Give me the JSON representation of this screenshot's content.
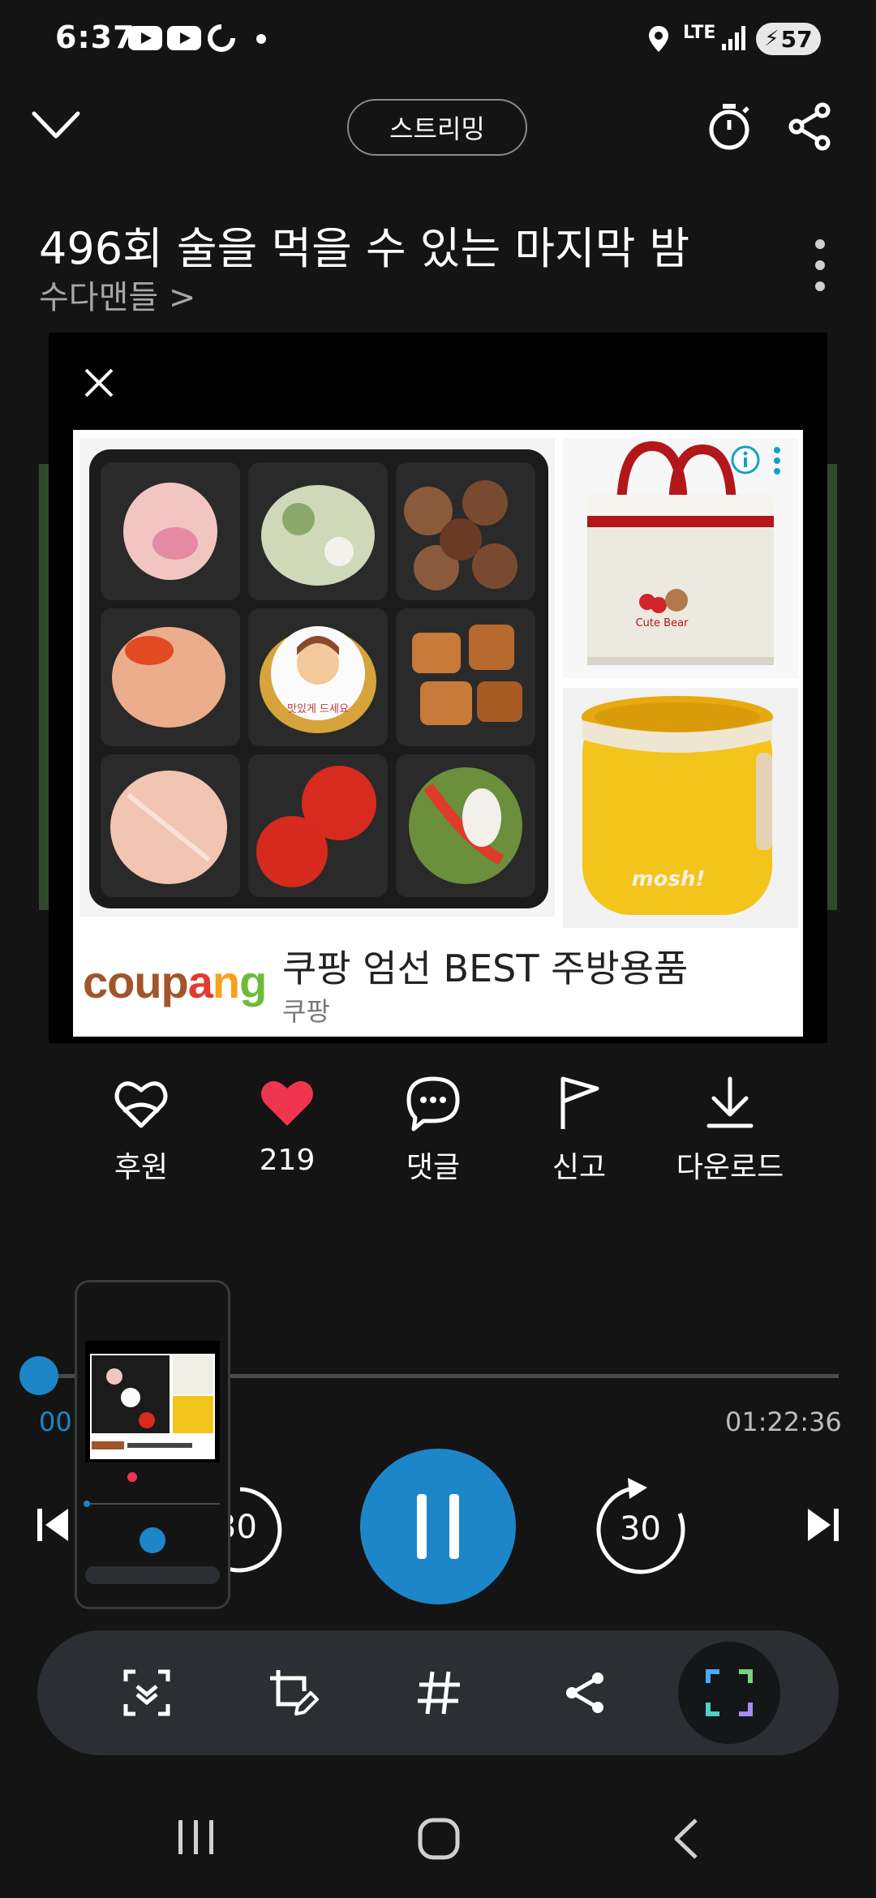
{
  "status_bar": {
    "time": "6:37",
    "network": "LTE",
    "battery": "57"
  },
  "header": {
    "streaming_label": "스트리밍",
    "episode_title": "496회 술을 먹을 수 있는 마지막 밤",
    "channel_name": "수다맨들 >"
  },
  "ad": {
    "brand": "coupang",
    "title": "쿠팡 엄선 BEST 주방용품",
    "advertiser": "쿠팡",
    "bag_text": "Cute Bear",
    "jar_text": "mosh!",
    "food_label": "맛있게 드세요"
  },
  "actions": [
    {
      "label": "후원",
      "icon": "gift-heart-icon"
    },
    {
      "label": "219",
      "icon": "heart-icon"
    },
    {
      "label": "댓글",
      "icon": "comment-icon"
    },
    {
      "label": "신고",
      "icon": "flag-icon"
    },
    {
      "label": "다운로드",
      "icon": "download-icon"
    }
  ],
  "player": {
    "current_time": "00",
    "total_time": "01:22:36",
    "rewind_label": "30",
    "forward_label": "30",
    "progress_fraction": 0.0
  },
  "colors": {
    "accent": "#1d86c8",
    "heart": "#f0354f",
    "background": "#141414"
  }
}
